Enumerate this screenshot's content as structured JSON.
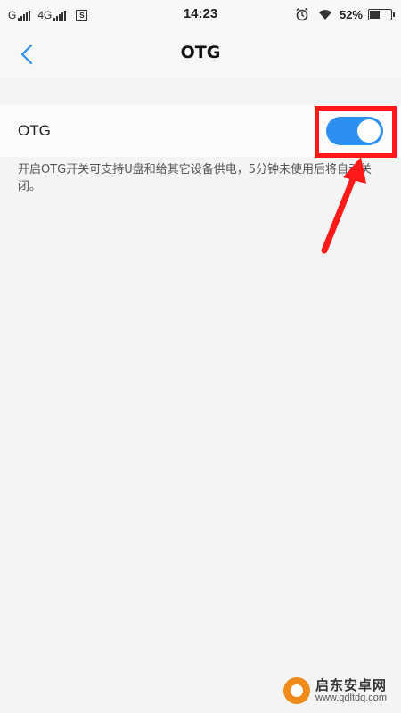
{
  "status_bar": {
    "carrier_1": "G",
    "carrier_2": "4G",
    "sim_label": "S",
    "time": "14:23",
    "battery_percent": "52%",
    "battery_level": 0.52,
    "icons": [
      "signal-icon",
      "sim-icon",
      "alarm-icon",
      "wifi-icon",
      "battery-icon"
    ]
  },
  "nav": {
    "title": "OTG",
    "back_icon": "chevron-left-icon"
  },
  "setting": {
    "label": "OTG",
    "toggle_on": true,
    "description": "开启OTG开关可支持U盘和给其它设备供电，5分钟未使用后将自动关闭。"
  },
  "annotation": {
    "highlight_color": "#ff1a1a",
    "arrow_color": "#ff1a1a"
  },
  "watermark": {
    "name": "启东安卓网",
    "url": "www.qdltdq.com"
  },
  "colors": {
    "accent": "#2d8ff0",
    "background": "#f4f4f4"
  }
}
